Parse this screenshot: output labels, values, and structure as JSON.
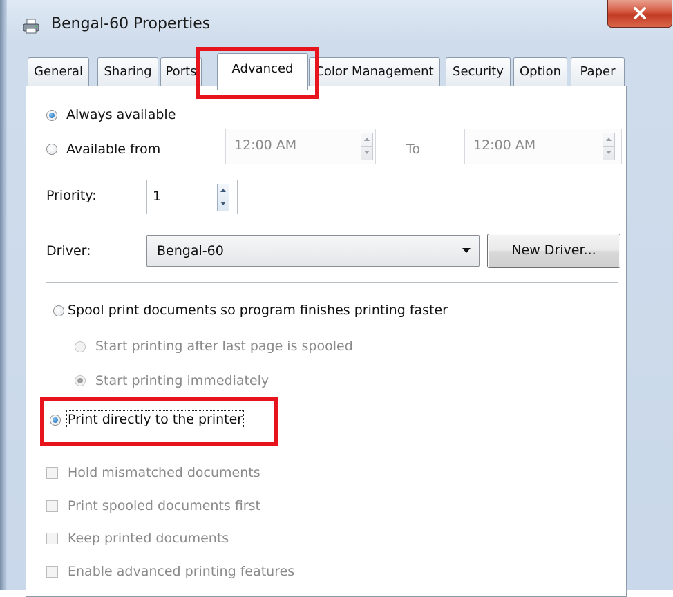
{
  "window": {
    "title": "Bengal-60 Properties",
    "close_glyph": "X",
    "icon": "printer-icon"
  },
  "tabs": [
    {
      "label": "General",
      "active": false
    },
    {
      "label": "Sharing",
      "active": false
    },
    {
      "label": "Ports",
      "active": false
    },
    {
      "label": "Advanced",
      "active": true
    },
    {
      "label": "Color Management",
      "active": false
    },
    {
      "label": "Security",
      "active": false
    },
    {
      "label": "Option",
      "active": false
    },
    {
      "label": "Paper",
      "active": false
    }
  ],
  "availability": {
    "always_label": "Always available",
    "always_selected": true,
    "from_label": "Available from",
    "from_time": "12:00 AM",
    "to_label": "To",
    "to_time": "12:00 AM"
  },
  "priority": {
    "label": "Priority:",
    "value": "1"
  },
  "driver": {
    "label": "Driver:",
    "value": "Bengal-60",
    "new_driver_label": "New Driver..."
  },
  "spooling": {
    "spool_label": "Spool print documents so program finishes printing faster",
    "after_last_page_label": "Start printing after last page is spooled",
    "immediately_label": "Start printing immediately",
    "direct_label": "Print directly to the printer",
    "direct_selected": true
  },
  "options": [
    {
      "label": "Hold mismatched documents",
      "checked": false,
      "enabled": false
    },
    {
      "label": "Print spooled documents first",
      "checked": false,
      "enabled": false
    },
    {
      "label": "Keep printed documents",
      "checked": false,
      "enabled": false
    },
    {
      "label": "Enable advanced printing features",
      "checked": false,
      "enabled": false
    }
  ],
  "colors": {
    "highlight": "#e8141d",
    "close_button": "#c23b22",
    "radio_selected": "#1d64b3"
  }
}
